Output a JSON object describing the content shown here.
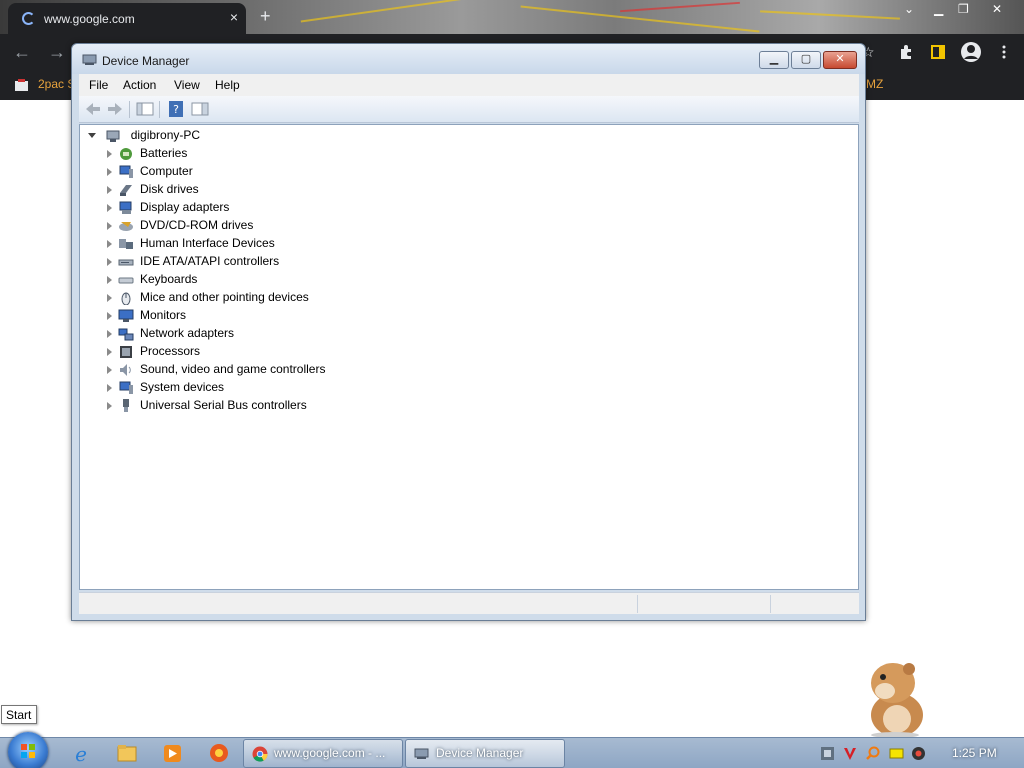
{
  "browser": {
    "tab_title": "www.google.com",
    "tab_close": "×",
    "new_tab": "+",
    "bookmark_first": "2pac S",
    "bookmark_last": "MZ"
  },
  "window": {
    "title": "Device Manager",
    "menu": [
      "File",
      "Action",
      "View",
      "Help"
    ]
  },
  "tree": {
    "root": "digibrony-PC",
    "items": [
      {
        "label": "Batteries",
        "icon": "battery-icon"
      },
      {
        "label": "Computer",
        "icon": "computer-icon"
      },
      {
        "label": "Disk drives",
        "icon": "disk-drive-icon"
      },
      {
        "label": "Display adapters",
        "icon": "display-adapter-icon"
      },
      {
        "label": "DVD/CD-ROM drives",
        "icon": "dvd-drive-icon"
      },
      {
        "label": "Human Interface Devices",
        "icon": "hid-icon"
      },
      {
        "label": "IDE ATA/ATAPI controllers",
        "icon": "ide-controller-icon"
      },
      {
        "label": "Keyboards",
        "icon": "keyboard-icon"
      },
      {
        "label": "Mice and other pointing devices",
        "icon": "mouse-icon"
      },
      {
        "label": "Monitors",
        "icon": "monitor-icon"
      },
      {
        "label": "Network adapters",
        "icon": "network-adapter-icon"
      },
      {
        "label": "Processors",
        "icon": "processor-icon"
      },
      {
        "label": "Sound, video and game controllers",
        "icon": "speaker-icon"
      },
      {
        "label": "System devices",
        "icon": "system-device-icon"
      },
      {
        "label": "Universal Serial Bus controllers",
        "icon": "usb-icon"
      }
    ]
  },
  "desktop": {
    "start_tooltip": "Start"
  },
  "taskbar": {
    "tasks": [
      {
        "label": "www.google.com - ...",
        "icon": "chrome-icon"
      },
      {
        "label": "Device Manager",
        "icon": "device-manager-icon"
      }
    ],
    "clock": "1:25 PM"
  }
}
